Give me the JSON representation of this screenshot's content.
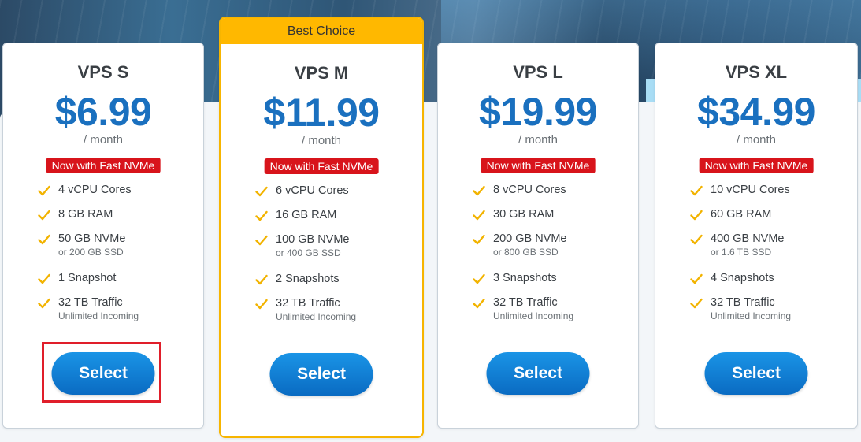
{
  "plans": [
    {
      "name": "VPS S",
      "price": "$6.99",
      "period": "/ month",
      "badge": "Now with Fast NVMe",
      "features": [
        {
          "main": "4 vCPU Cores",
          "sub": ""
        },
        {
          "main": "8 GB RAM",
          "sub": ""
        },
        {
          "main": "50 GB NVMe",
          "sub": "or 200 GB SSD"
        },
        {
          "main": "1 Snapshot",
          "sub": ""
        },
        {
          "main": "32 TB Traffic",
          "sub": "Unlimited Incoming"
        }
      ],
      "button": "Select"
    },
    {
      "name": "VPS M",
      "price": "$11.99",
      "period": "/ month",
      "badge": "Now with Fast NVMe",
      "ribbon": "Best Choice",
      "features": [
        {
          "main": "6 vCPU Cores",
          "sub": ""
        },
        {
          "main": "16 GB RAM",
          "sub": ""
        },
        {
          "main": "100 GB NVMe",
          "sub": "or 400 GB SSD"
        },
        {
          "main": "2 Snapshots",
          "sub": ""
        },
        {
          "main": "32 TB Traffic",
          "sub": "Unlimited Incoming"
        }
      ],
      "button": "Select"
    },
    {
      "name": "VPS L",
      "price": "$19.99",
      "period": "/ month",
      "badge": "Now with Fast NVMe",
      "features": [
        {
          "main": "8 vCPU Cores",
          "sub": ""
        },
        {
          "main": "30 GB RAM",
          "sub": ""
        },
        {
          "main": "200 GB NVMe",
          "sub": "or 800 GB SSD"
        },
        {
          "main": "3 Snapshots",
          "sub": ""
        },
        {
          "main": "32 TB Traffic",
          "sub": "Unlimited Incoming"
        }
      ],
      "button": "Select"
    },
    {
      "name": "VPS XL",
      "price": "$34.99",
      "period": "/ month",
      "badge": "Now with Fast NVMe",
      "features": [
        {
          "main": "10 vCPU Cores",
          "sub": ""
        },
        {
          "main": "60 GB RAM",
          "sub": ""
        },
        {
          "main": "400 GB NVMe",
          "sub": "or 1.6 TB SSD"
        },
        {
          "main": "4 Snapshots",
          "sub": ""
        },
        {
          "main": "32 TB Traffic",
          "sub": "Unlimited Incoming"
        }
      ],
      "button": "Select"
    }
  ],
  "icons": {
    "feature_bullet": "check-icon"
  },
  "colors": {
    "price": "#1a70bf",
    "badge": "#d8141b",
    "ribbon": "#ffb800",
    "button": "#0a6bc2",
    "check": "#f2b300",
    "highlight": "#e01e2a"
  }
}
